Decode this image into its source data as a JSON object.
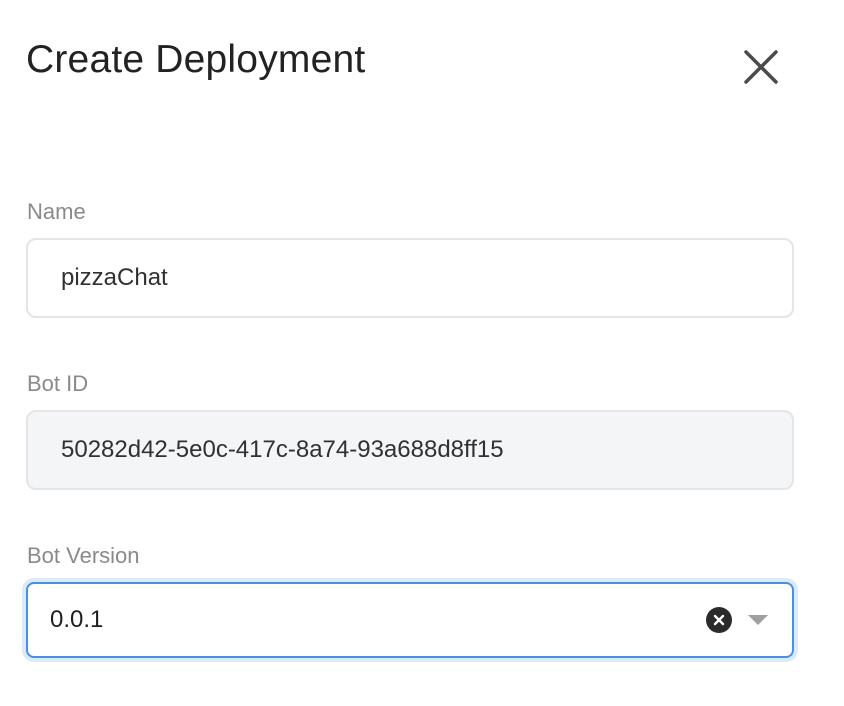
{
  "dialog": {
    "title": "Create Deployment",
    "close_icon": "close-icon"
  },
  "form": {
    "name": {
      "label": "Name",
      "value": "pizzaChat"
    },
    "bot_id": {
      "label": "Bot ID",
      "value": "50282d42-5e0c-417c-8a74-93a688d8ff15"
    },
    "bot_version": {
      "label": "Bot Version",
      "value": "0.0.1",
      "clear_icon": "clear-circle-icon",
      "dropdown_icon": "caret-down-icon"
    }
  },
  "colors": {
    "focus_border": "#4a90e2",
    "focus_glow": "#dcebfb",
    "label": "#8a8a8a",
    "field_border": "#e3e5e8",
    "readonly_bg": "#f4f5f7"
  }
}
